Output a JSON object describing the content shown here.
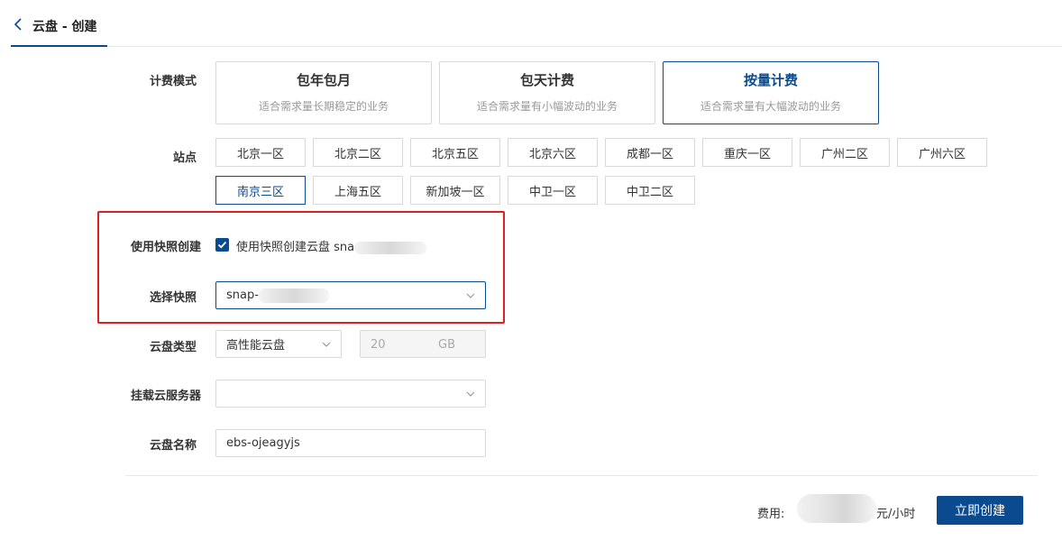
{
  "header": {
    "title": "云盘 - 创建",
    "back_icon": "chevron-left-icon"
  },
  "colors": {
    "accent": "#0b4a8f",
    "highlight_border": "#e02020"
  },
  "billing": {
    "label": "计费模式",
    "options": [
      {
        "title": "包年包月",
        "desc": "适合需求量长期稳定的业务",
        "active": false
      },
      {
        "title": "包天计费",
        "desc": "适合需求量有小幅波动的业务",
        "active": false
      },
      {
        "title": "按量计费",
        "desc": "适合需求量有大幅波动的业务",
        "active": true
      }
    ]
  },
  "site": {
    "label": "站点",
    "options": [
      "北京一区",
      "北京二区",
      "北京五区",
      "北京六区",
      "成都一区",
      "重庆一区",
      "广州二区",
      "广州六区",
      "南京三区",
      "上海五区",
      "新加坡一区",
      "中卫一区",
      "中卫二区"
    ],
    "selected": "南京三区"
  },
  "snapshot_create": {
    "label": "使用快照创建",
    "checked": true,
    "checkbox_text": "使用快照创建云盘 sna"
  },
  "snapshot_select": {
    "label": "选择快照",
    "value": "snap-"
  },
  "disk_type": {
    "label": "云盘类型",
    "value": "高性能云盘",
    "size_value": "20",
    "size_unit": "GB"
  },
  "mount_server": {
    "label": "挂载云服务器",
    "value": ""
  },
  "disk_name": {
    "label": "云盘名称",
    "value": "ebs-ojeagyjs"
  },
  "footer": {
    "fee_label": "费用:",
    "fee_unit": "元/小时",
    "create_label": "立即创建"
  }
}
